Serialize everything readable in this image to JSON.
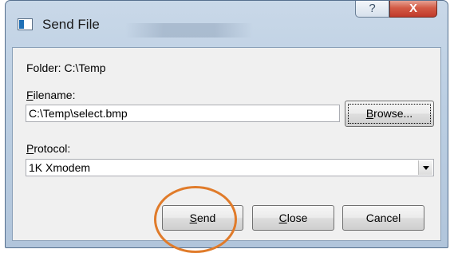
{
  "window": {
    "title": "Send File",
    "help_label": "?",
    "close_label": "X"
  },
  "folder": {
    "label": "Folder:",
    "value": "C:\\Temp"
  },
  "filename": {
    "label_first": "F",
    "label_rest": "ilename:",
    "value": "C:\\Temp\\select.bmp"
  },
  "browse_button": {
    "mnemonic": "B",
    "rest": "rowse..."
  },
  "protocol": {
    "label_first": "P",
    "label_rest": "rotocol:",
    "selected": "1K Xmodem"
  },
  "buttons": {
    "send": {
      "mnemonic": "S",
      "rest": "end"
    },
    "close": {
      "mnemonic": "C",
      "rest": "lose"
    },
    "cancel": {
      "label": "Cancel"
    }
  },
  "annotation": {
    "highlight_color": "#e07b2a"
  },
  "colors": {
    "title_bar": "#bccfe3",
    "close_button": "#c0392b",
    "dialog_bg": "#f0f0f0"
  }
}
